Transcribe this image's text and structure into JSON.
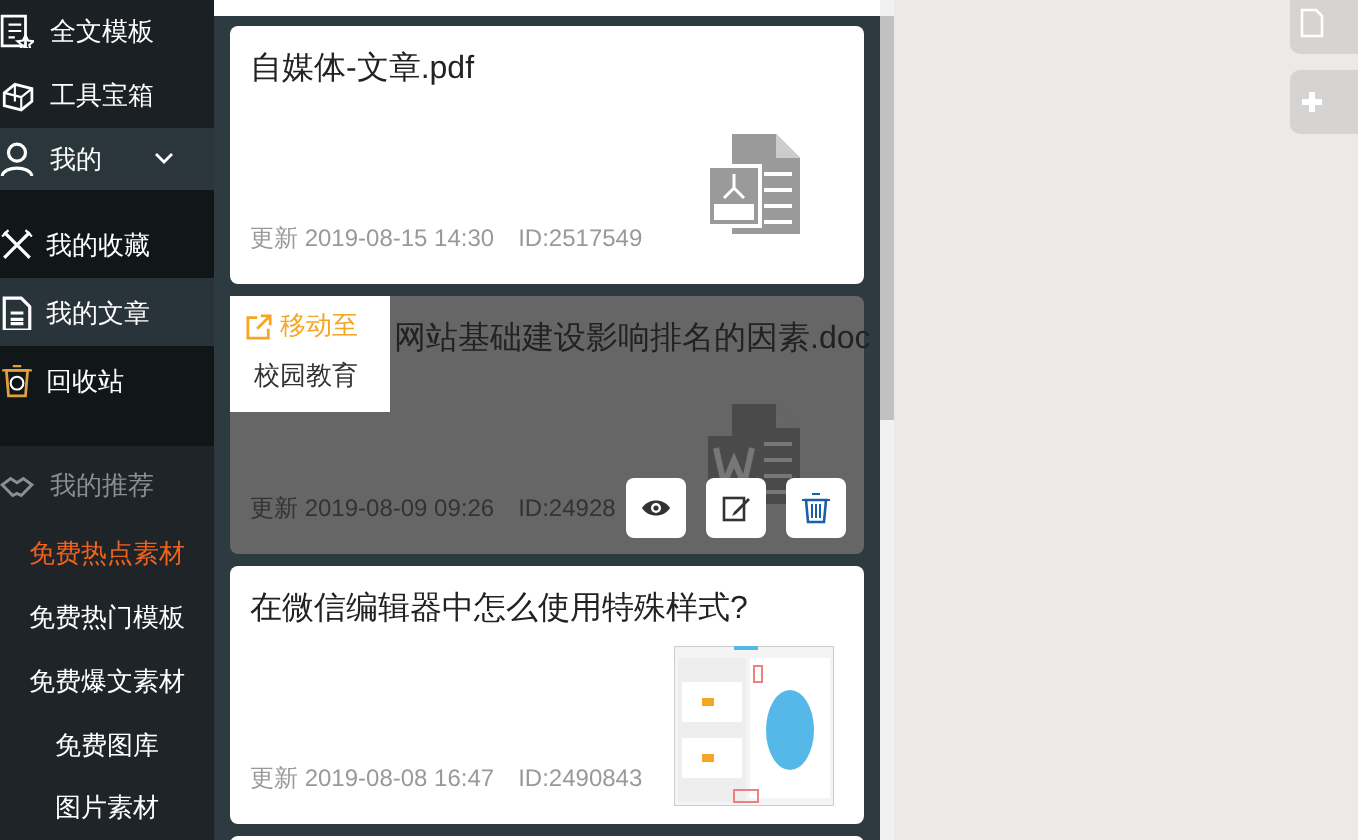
{
  "sidebar": {
    "items": [
      {
        "kind": "template",
        "label": "全文模板"
      },
      {
        "kind": "toolbox",
        "label": "工具宝箱"
      },
      {
        "kind": "user",
        "label": "我的",
        "expanded": true,
        "children": [
          {
            "kind": "favorites",
            "label": "我的收藏",
            "selected": false
          },
          {
            "kind": "article",
            "label": "我的文章",
            "selected": true
          },
          {
            "kind": "recycle",
            "label": "回收站",
            "selected": false
          }
        ]
      },
      {
        "kind": "recommend",
        "label": "我的推荐",
        "children": [
          {
            "label": "免费热点素材",
            "selected": true
          },
          {
            "label": "免费热门模板",
            "selected": false
          },
          {
            "label": "免费爆文素材",
            "selected": false
          },
          {
            "label": "免费图库",
            "selected": false
          },
          {
            "label": "图片素材",
            "selected": false
          }
        ]
      }
    ]
  },
  "cards": [
    {
      "title": "自媒体-文章.pdf",
      "updated": "更新 2019-08-15 14:30",
      "id": "ID:2517549",
      "kind": "pdf",
      "hovered": false
    },
    {
      "title": "网站基础建设影响排名的因素.doc",
      "updated": "更新 2019-08-09 09:26",
      "id": "ID:24928",
      "kind": "doc",
      "hovered": true,
      "menu": {
        "title": "移动至",
        "items": [
          "校园教育"
        ]
      }
    },
    {
      "title": "在微信编辑器中怎么使用特殊样式?",
      "updated": "更新 2019-08-08 16:47",
      "id": "ID:2490843",
      "kind": "picture",
      "hovered": false
    }
  ],
  "side_buttons": [
    {
      "kind": "document"
    },
    {
      "kind": "new"
    }
  ]
}
